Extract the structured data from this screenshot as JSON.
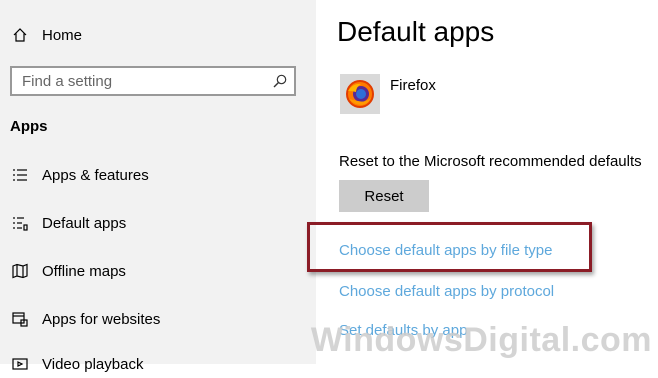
{
  "sidebar": {
    "home_label": "Home",
    "search_placeholder": "Find a setting",
    "section_title": "Apps",
    "items": [
      {
        "label": "Apps & features"
      },
      {
        "label": "Default apps"
      },
      {
        "label": "Offline maps"
      },
      {
        "label": "Apps for websites"
      },
      {
        "label": "Video playback"
      }
    ]
  },
  "main": {
    "title": "Default apps",
    "app_name": "Firefox",
    "app_icon": "firefox-icon",
    "reset_label": "Reset to the Microsoft recommended defaults",
    "reset_button": "Reset",
    "links": [
      {
        "label": "Choose default apps by file type"
      },
      {
        "label": "Choose default apps by protocol"
      },
      {
        "label": "Set defaults by app"
      }
    ]
  },
  "watermark": "WindowsDigital.com",
  "colors": {
    "link": "#5ea8dc",
    "highlight_border": "#8b1c26",
    "sidebar_bg": "#f2f2f2"
  }
}
